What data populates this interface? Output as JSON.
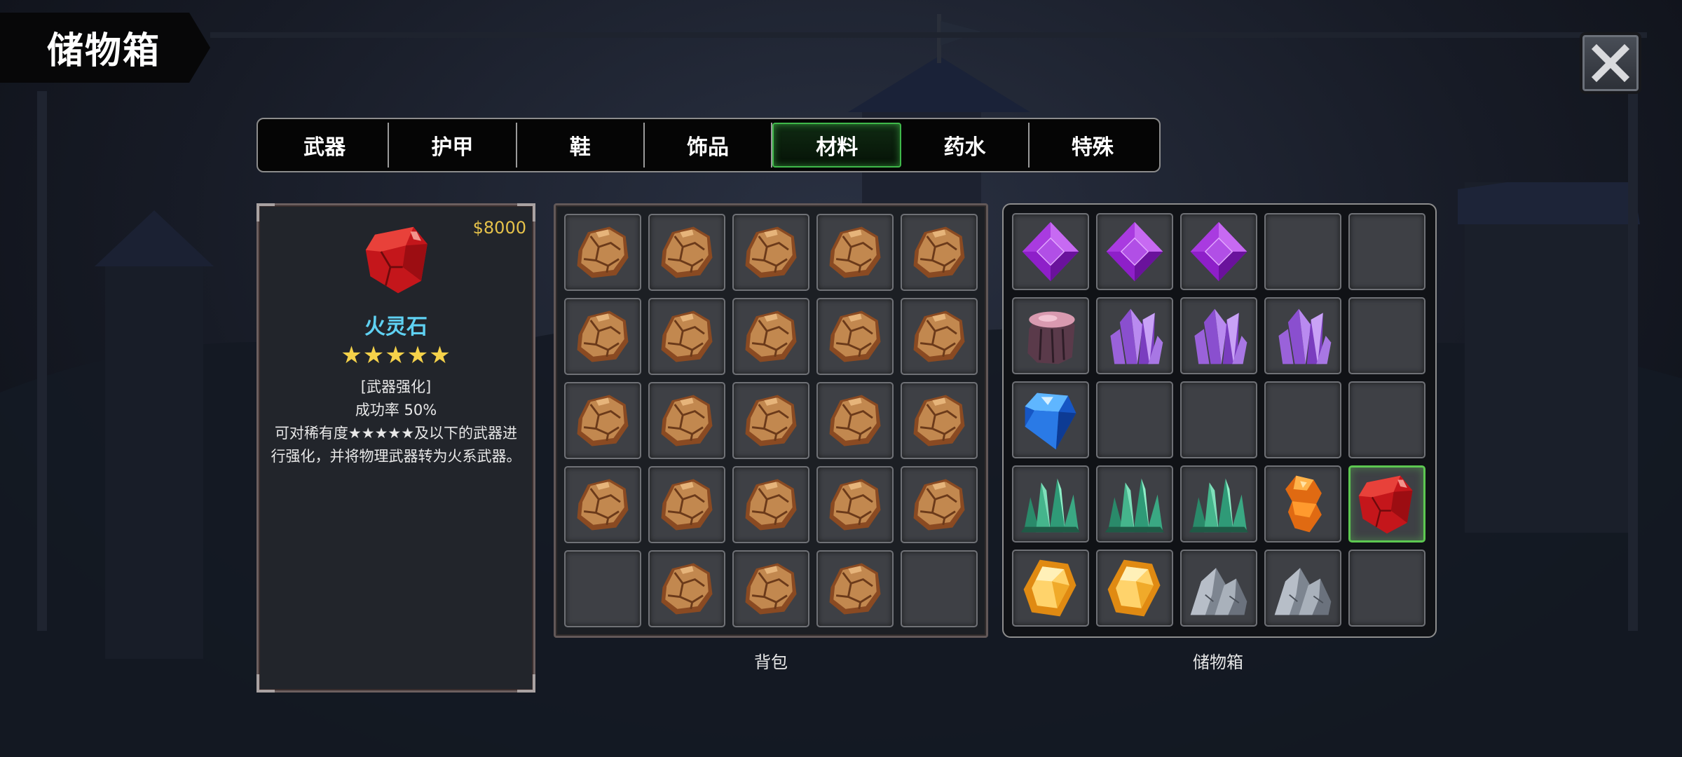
{
  "title": "储物箱",
  "close_icon": "close-x-icon",
  "tabs": [
    {
      "label": "武器",
      "active": false
    },
    {
      "label": "护甲",
      "active": false
    },
    {
      "label": "鞋",
      "active": false
    },
    {
      "label": "饰品",
      "active": false
    },
    {
      "label": "材料",
      "active": true
    },
    {
      "label": "药水",
      "active": false
    },
    {
      "label": "特殊",
      "active": false
    }
  ],
  "detail": {
    "price": "$8000",
    "icon": "fire-spirit-stone-icon",
    "name": "火灵石",
    "stars": "★★★★★",
    "rarity": 5,
    "category": "[武器强化]",
    "success_rate": "成功率  50%",
    "description": "可对稀有度★★★★★及以下的武器进行强化，并将物理武器转为火系武器。"
  },
  "backpack": {
    "label": "背包",
    "slots": [
      "rough-stone-icon",
      "rough-stone-icon",
      "rough-stone-icon",
      "rough-stone-icon",
      "rough-stone-icon",
      "rough-stone-icon",
      "rough-stone-icon",
      "rough-stone-icon",
      "rough-stone-icon",
      "rough-stone-icon",
      "rough-stone-icon",
      "rough-stone-icon",
      "rough-stone-icon",
      "rough-stone-icon",
      "rough-stone-icon",
      "rough-stone-icon",
      "rough-stone-icon",
      "rough-stone-icon",
      "rough-stone-icon",
      "rough-stone-icon",
      null,
      "rough-stone-icon",
      "rough-stone-icon",
      "rough-stone-icon",
      null
    ]
  },
  "storage": {
    "label": "储物箱",
    "selected_index": 19,
    "slots": [
      "purple-diamond-icon",
      "purple-diamond-icon",
      "purple-diamond-icon",
      null,
      null,
      "pink-ore-icon",
      "purple-crystal-cluster-icon",
      "purple-crystal-cluster-icon",
      "purple-crystal-cluster-icon",
      null,
      "blue-gem-icon",
      null,
      null,
      null,
      null,
      "green-crystal-cluster-icon",
      "green-crystal-cluster-icon",
      "green-crystal-cluster-icon",
      "orange-amber-icon",
      "fire-spirit-stone-icon",
      "gold-gem-icon",
      "gold-gem-icon",
      "grey-rock-icon",
      "grey-rock-icon",
      null
    ]
  },
  "colors": {
    "accent_green": "#3fb84a",
    "item_name": "#5fd1f2",
    "price": "#e6c24a",
    "stars": "#f5d24a"
  }
}
